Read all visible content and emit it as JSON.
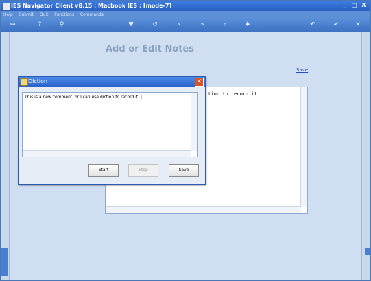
{
  "window": {
    "title": "IES Navigator Client v8.15 : Macbook IES :      [mode-7]"
  },
  "window_controls": {
    "minimize": "_",
    "maximize": "□",
    "close": "X"
  },
  "menu": [
    "Help",
    "Submit",
    "Quit",
    "Functions",
    "Commands"
  ],
  "toolbar": {
    "key_icon": "⊶",
    "help_icon": "?",
    "search_icon": "⚲",
    "heart_icon": "♥",
    "refresh_icon": "↺",
    "prev_icon": "«",
    "next_icon": "»",
    "tree_icon": "⑂",
    "gear_icon": "✱",
    "back_icon": "↶",
    "check_icon": "✔",
    "close_icon": "✕"
  },
  "page": {
    "title": "Add or Edit Notes",
    "save_link": "Save",
    "notes_text": "ction to record it."
  },
  "dialog": {
    "title": "Diction",
    "close_icon": "✕",
    "text": "This is a new comment, or I can use diction to record it. |",
    "buttons": {
      "start": "Start",
      "stop": "Stop",
      "save": "Save"
    }
  },
  "colors": {
    "titlebar": "#2f6ad0",
    "background": "#cfdff1",
    "link": "#2b4fb6"
  }
}
